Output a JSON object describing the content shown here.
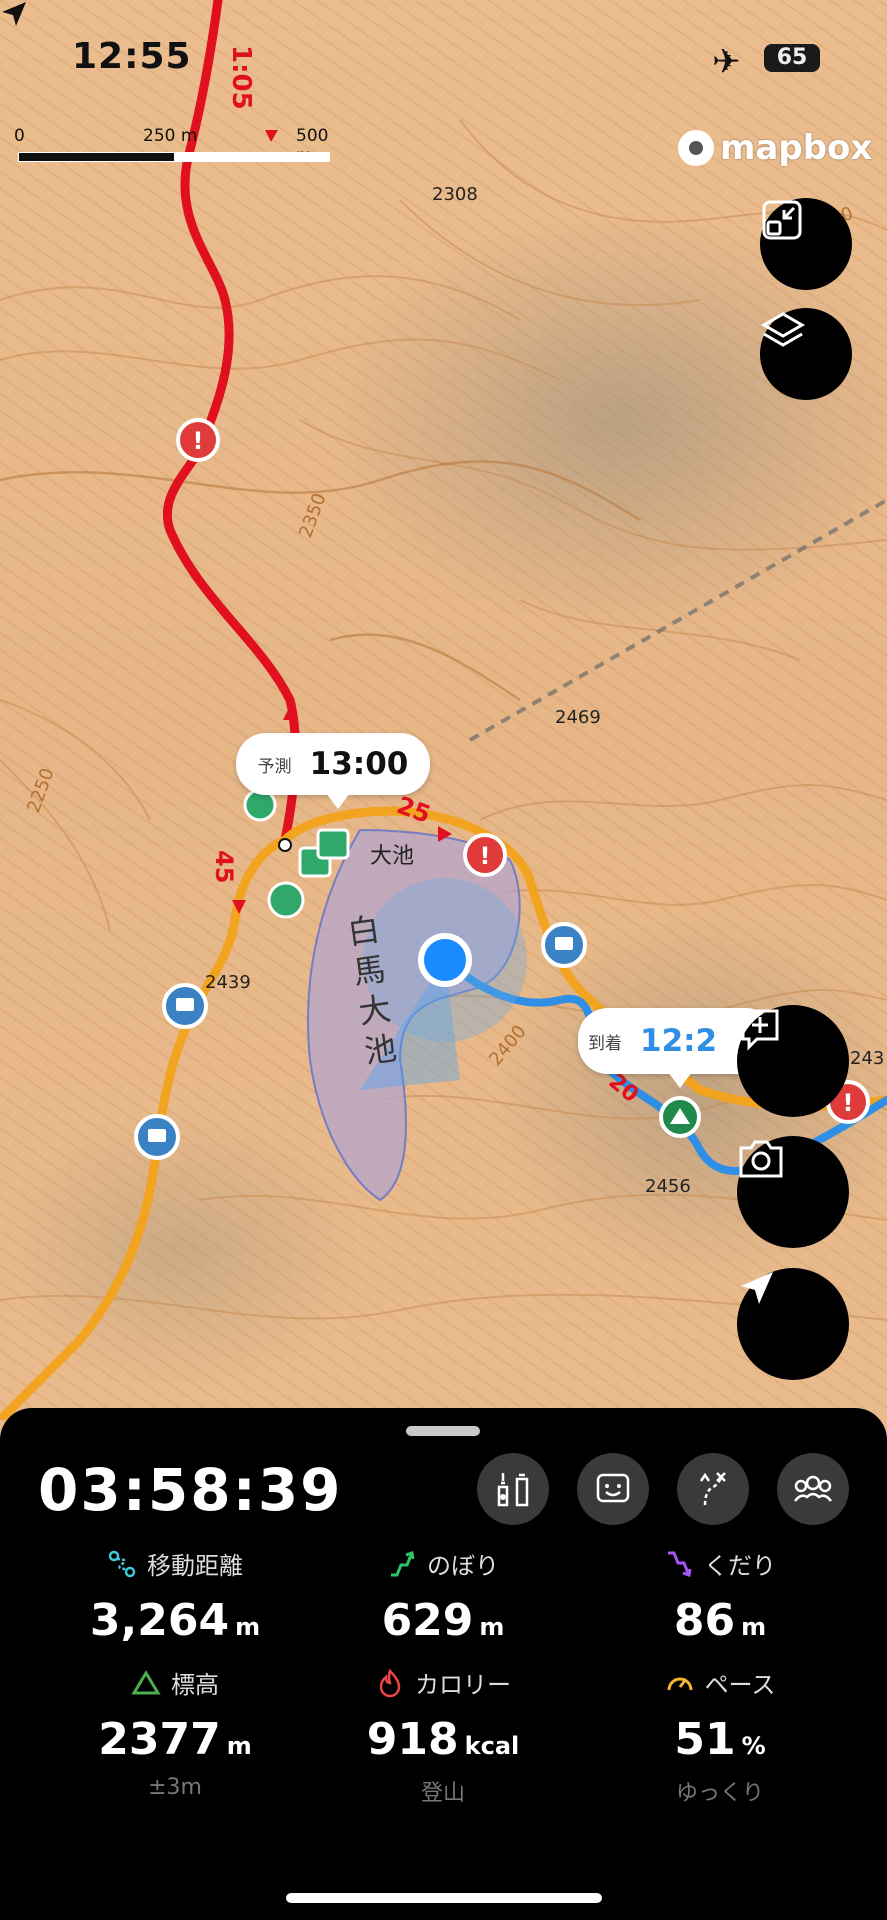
{
  "status_bar": {
    "time": "12:55",
    "battery": "65"
  },
  "map": {
    "scale": {
      "labels": [
        "0",
        "250 m",
        "500 m"
      ]
    },
    "brand": "mapbox",
    "lake_label": "白馬大池",
    "elevation_labels": [
      "2308",
      "2350",
      "2469",
      "2439",
      "2400",
      "2456",
      "2250",
      "2000",
      "243"
    ],
    "route_times": [
      "1:05",
      "45",
      "25",
      "20"
    ],
    "pond_label": "大池",
    "predicted": {
      "label": "予測",
      "time": "13:00"
    },
    "arrival": {
      "label": "到着",
      "time": "12:2"
    }
  },
  "panel": {
    "elapsed": "03:58:39",
    "stats": [
      {
        "label": "移動距離",
        "value": "3,264",
        "unit": "m",
        "sub": "",
        "color": "#3ec7d6"
      },
      {
        "label": "のぼり",
        "value": "629",
        "unit": "m",
        "sub": "",
        "color": "#2ec46b"
      },
      {
        "label": "くだり",
        "value": "86",
        "unit": "m",
        "sub": "",
        "color": "#a855f7"
      },
      {
        "label": "標高",
        "value": "2377",
        "unit": "m",
        "sub": "±3m",
        "color": "#4caf50"
      },
      {
        "label": "カロリー",
        "value": "918",
        "unit": "kcal",
        "sub": "登山",
        "color": "#ef4444"
      },
      {
        "label": "ペース",
        "value": "51",
        "unit": "%",
        "sub": "ゆっくり",
        "color": "#f5b533"
      }
    ]
  },
  "colors": {
    "route_red": "#e0101e",
    "route_orange": "#f2a31f",
    "route_blue": "#2f8fe6",
    "location": "#1a8cff"
  }
}
